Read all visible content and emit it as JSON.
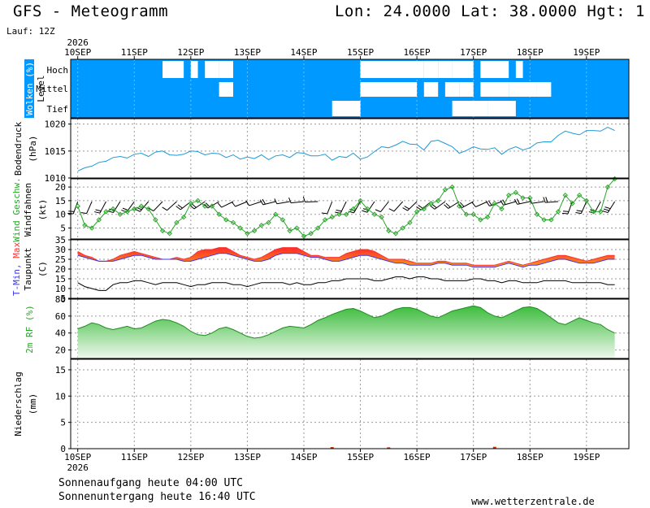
{
  "header": {
    "title": "GFS - Meteogramm",
    "location": "Lon: 24.0000 Lat: 38.0000 Hgt: 1",
    "run": "Lauf: 12Z"
  },
  "footer": {
    "sunrise": "Sonnenaufgang heute 04:00 UTC",
    "sunset": "Sonnenuntergang heute 16:40 UTC",
    "website": "www.wetterzentrale.de"
  },
  "chart_data": {
    "type": "line",
    "x_axis": {
      "year": "2026",
      "day_labels": [
        "10SEP",
        "11SEP",
        "12SEP",
        "13SEP",
        "14SEP",
        "15SEP",
        "16SEP",
        "17SEP",
        "18SEP",
        "19SEP"
      ],
      "start_hour_offset": -3,
      "end_hour_offset": 234,
      "steps_per_day": 8
    },
    "panels": [
      {
        "id": "clouds",
        "ylabel": "Wolken (%)",
        "ylabel2": "Level",
        "level_labels": [
          "Hoch",
          "Mittel",
          "Tief"
        ],
        "background": "#0099ff",
        "gaps": [
          {
            "level": "high",
            "start": 12,
            "end": 15
          },
          {
            "level": "high",
            "start": 16,
            "end": 17
          },
          {
            "level": "high",
            "start": 18,
            "end": 20
          },
          {
            "level": "high",
            "start": 20,
            "end": 22
          },
          {
            "level": "high",
            "start": 40,
            "end": 49
          },
          {
            "level": "high",
            "start": 49,
            "end": 51
          },
          {
            "level": "high",
            "start": 51,
            "end": 53
          },
          {
            "level": "high",
            "start": 53,
            "end": 55
          },
          {
            "level": "high",
            "start": 55,
            "end": 56
          },
          {
            "level": "high",
            "start": 57,
            "end": 61
          },
          {
            "level": "high",
            "start": 62,
            "end": 63
          },
          {
            "level": "mid",
            "start": 20,
            "end": 22
          },
          {
            "level": "mid",
            "start": 40,
            "end": 48
          },
          {
            "level": "mid",
            "start": 49,
            "end": 51
          },
          {
            "level": "mid",
            "start": 52,
            "end": 54
          },
          {
            "level": "mid",
            "start": 54,
            "end": 56
          },
          {
            "level": "mid",
            "start": 57,
            "end": 61
          },
          {
            "level": "mid",
            "start": 61,
            "end": 65
          },
          {
            "level": "mid",
            "start": 65,
            "end": 67
          },
          {
            "level": "low",
            "start": 36,
            "end": 38
          },
          {
            "level": "low",
            "start": 37,
            "end": 40
          },
          {
            "level": "low",
            "start": 53,
            "end": 58
          },
          {
            "level": "low",
            "start": 58,
            "end": 62
          }
        ]
      },
      {
        "id": "pressure",
        "ylabel": "Bodendruck",
        "ylabel2": "(hPa)",
        "ylim": [
          1010,
          1021
        ],
        "yticks": [
          1010,
          1015,
          1020
        ],
        "color": "#1e9ad6",
        "series": [
          {
            "values": [
              1011.3,
              1011.9,
              1012.2,
              1012.9,
              1013.1,
              1013.8,
              1014.0,
              1013.7,
              1014.4,
              1014.6,
              1014.0,
              1014.8,
              1015.0,
              1014.3,
              1014.2,
              1014.4,
              1015.0,
              1014.9,
              1014.3,
              1014.6,
              1014.5,
              1013.8,
              1014.3,
              1013.5,
              1013.9,
              1013.6,
              1014.3,
              1013.4,
              1014.1,
              1014.3,
              1013.8,
              1014.7,
              1014.6,
              1014.1,
              1014.1,
              1014.4,
              1013.3,
              1014.0,
              1013.8,
              1014.6,
              1013.5,
              1013.9,
              1014.9,
              1015.8,
              1015.6,
              1016.1,
              1016.8,
              1016.3,
              1016.2,
              1015.2,
              1016.8,
              1017.0,
              1016.4,
              1015.8,
              1014.6,
              1015.1,
              1015.8,
              1015.4,
              1015.3,
              1015.6,
              1014.4,
              1015.3,
              1015.8,
              1015.2,
              1015.6,
              1016.5,
              1016.7,
              1016.7,
              1017.9,
              1018.7,
              1018.3,
              1018.0,
              1018.8,
              1018.8,
              1018.7,
              1019.4,
              1018.8
            ]
          }
        ]
      },
      {
        "id": "wind",
        "ylabel": "Wind Geschw.",
        "ylabel2": "Windfahnen",
        "ylabel3": "(kt)",
        "ylim": [
          1,
          23
        ],
        "yticks": [
          5,
          10,
          15,
          20
        ],
        "color": "#2aa62a",
        "series": [
          {
            "values": [
              13,
              6,
              5,
              8,
              11,
              12,
              10,
              11,
              12,
              13,
              12,
              8,
              4,
              3,
              7,
              9,
              14,
              15,
              13,
              13,
              10,
              8,
              7,
              5,
              3,
              4,
              6,
              7,
              10,
              8,
              4,
              5,
              2,
              3,
              5,
              8,
              9,
              10,
              10,
              12,
              15,
              12,
              10,
              9,
              4,
              3,
              5,
              7,
              11,
              12,
              14,
              15,
              19,
              20,
              13,
              10,
              10,
              8,
              9,
              14,
              12,
              17,
              18,
              16,
              16,
              10,
              8,
              8,
              11,
              17,
              14,
              17,
              15,
              11,
              11,
              20,
              23
            ]
          }
        ]
      },
      {
        "id": "temperature",
        "ylabel": "T-Min, Max",
        "ylabel2": "Taupunkt",
        "ylabel3": "(C)",
        "ylim": [
          5,
          35
        ],
        "yticks": [
          5,
          10,
          15,
          20,
          25,
          30,
          35
        ],
        "colors": {
          "tmax": "#ff3030",
          "tmin": "#3a3ae6",
          "band": "#ff8c1a",
          "dewpoint": "#000000"
        },
        "series": [
          {
            "name": "T-Min",
            "values": [
              27,
              26,
              25,
              24,
              24,
              24,
              25,
              26,
              27,
              27,
              26,
              25,
              25,
              25,
              25,
              24,
              24,
              25,
              26,
              27,
              28,
              28,
              27,
              26,
              25,
              24,
              24,
              25,
              27,
              28,
              28,
              28,
              27,
              26,
              26,
              25,
              24,
              24,
              25,
              26,
              27,
              27,
              26,
              25,
              24,
              23,
              23,
              22,
              22,
              22,
              22,
              23,
              23,
              22,
              22,
              22,
              21,
              21,
              21,
              21,
              22,
              23,
              22,
              21,
              22,
              22,
              23,
              24,
              25,
              25,
              24,
              23,
              23,
              23,
              24,
              25,
              25
            ]
          },
          {
            "name": "T-Max",
            "values": [
              29,
              27,
              26,
              24,
              24,
              25,
              27,
              28,
              29,
              28,
              27,
              26,
              25,
              25,
              26,
              25,
              26,
              29,
              30,
              30,
              31,
              31,
              29,
              27,
              26,
              25,
              26,
              28,
              30,
              31,
              31,
              31,
              29,
              27,
              27,
              26,
              26,
              26,
              28,
              29,
              30,
              30,
              29,
              27,
              25,
              25,
              25,
              24,
              23,
              23,
              23,
              24,
              24,
              23,
              23,
              23,
              22,
              22,
              22,
              22,
              23,
              24,
              23,
              22,
              23,
              24,
              25,
              26,
              27,
              27,
              26,
              25,
              24,
              25,
              26,
              27,
              27
            ]
          },
          {
            "name": "Taupunkt",
            "values": [
              13,
              11,
              10,
              9,
              9,
              12,
              13,
              13,
              14,
              14,
              13,
              12,
              13,
              13,
              13,
              12,
              11,
              12,
              12,
              13,
              13,
              13,
              12,
              12,
              11,
              12,
              13,
              13,
              13,
              13,
              12,
              13,
              12,
              12,
              13,
              13,
              14,
              14,
              15,
              15,
              15,
              15,
              14,
              14,
              15,
              16,
              16,
              15,
              16,
              16,
              15,
              15,
              14,
              14,
              14,
              14,
              15,
              15,
              14,
              14,
              13,
              14,
              14,
              13,
              13,
              13,
              14,
              14,
              14,
              14,
              13,
              13,
              13,
              13,
              13,
              12,
              12
            ]
          }
        ]
      },
      {
        "id": "humidity",
        "ylabel": "2m RF (%)",
        "ylim": [
          10,
          80
        ],
        "yticks": [
          20,
          40,
          60,
          80
        ],
        "colors": {
          "fill_top": "#56c856",
          "fill_bottom": "#e4f5e4",
          "line": "#1e8c1e"
        },
        "series": [
          {
            "values": [
              45,
              48,
              52,
              50,
              46,
              44,
              46,
              48,
              45,
              46,
              50,
              54,
              56,
              55,
              52,
              48,
              42,
              38,
              37,
              40,
              45,
              47,
              44,
              40,
              36,
              34,
              35,
              38,
              42,
              46,
              48,
              47,
              46,
              50,
              55,
              58,
              62,
              65,
              68,
              69,
              66,
              62,
              58,
              60,
              64,
              68,
              70,
              70,
              68,
              64,
              60,
              58,
              62,
              66,
              68,
              70,
              72,
              70,
              64,
              60,
              58,
              62,
              66,
              70,
              71,
              69,
              64,
              58,
              52,
              50,
              54,
              58,
              55,
              52,
              50,
              44,
              40
            ]
          }
        ]
      },
      {
        "id": "precipitation",
        "ylabel": "Niederschlag",
        "ylabel2": "(mm)",
        "ylim": [
          0,
          17
        ],
        "yticks": [
          0,
          5,
          10,
          15
        ],
        "color": "#cc3300",
        "series": [
          {
            "values": [
              0,
              0,
              0,
              0,
              0,
              0,
              0,
              0,
              0,
              0,
              0,
              0,
              0,
              0,
              0,
              0,
              0,
              0,
              0,
              0,
              0,
              0,
              0,
              0,
              0,
              0,
              0,
              0,
              0,
              0,
              0,
              0,
              0,
              0,
              0,
              0,
              0.15,
              0,
              0,
              0,
              0,
              0,
              0,
              0,
              0.1,
              0,
              0,
              0,
              0,
              0,
              0,
              0,
              0,
              0,
              0,
              0,
              0,
              0,
              0,
              0.2,
              0,
              0,
              0,
              0,
              0,
              0,
              0,
              0,
              0,
              0,
              0,
              0,
              0,
              0,
              0,
              0,
              0
            ]
          }
        ]
      }
    ]
  }
}
